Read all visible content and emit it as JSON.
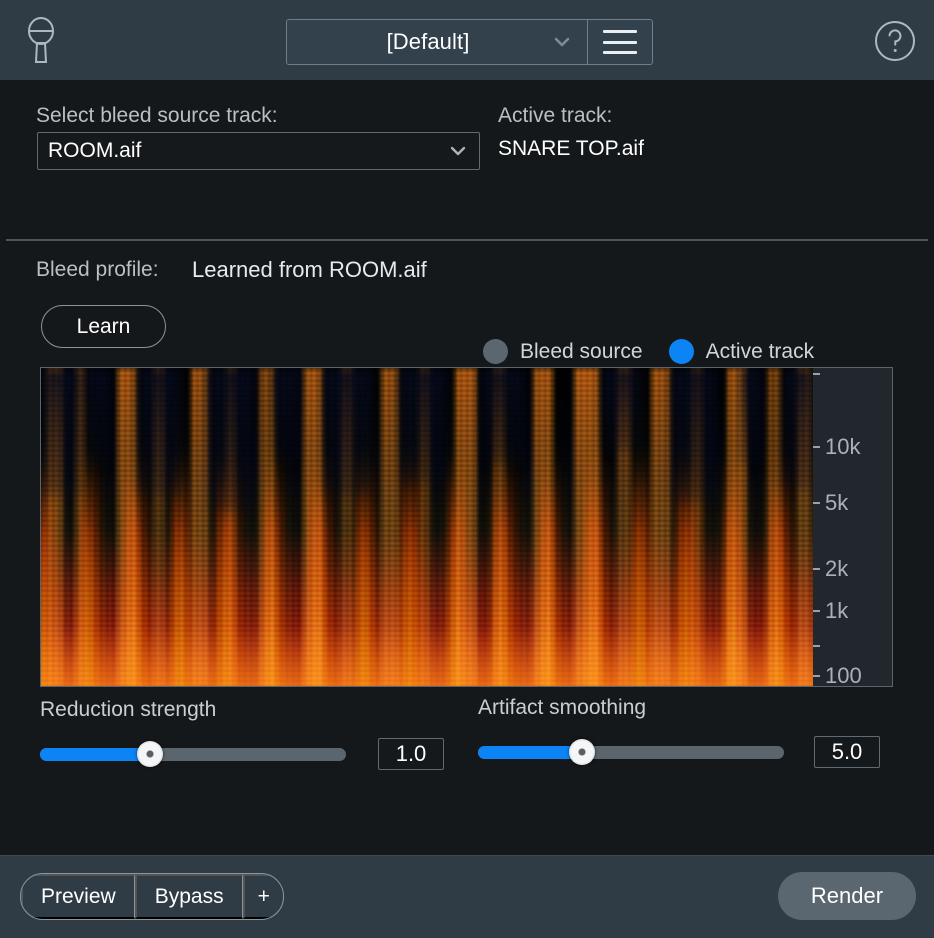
{
  "header": {
    "mic_icon": "microphone-icon",
    "help_icon": "help-icon",
    "preset_value": "[Default]",
    "preset_chevron": "chevron-down-icon",
    "menu_icon": "hamburger-menu-icon"
  },
  "top": {
    "bleed_source_label": "Select bleed source track:",
    "bleed_source_value": "ROOM.aif",
    "active_track_label": "Active track:",
    "active_track_value": "SNARE TOP.aif"
  },
  "profile": {
    "label": "Bleed profile:",
    "value": "Learned from ROOM.aif",
    "learn_button": "Learn"
  },
  "legend": {
    "items": [
      {
        "label": "Bleed source",
        "color": "#5b6670",
        "selected": false
      },
      {
        "label": "Active track",
        "color": "#0c84f5",
        "selected": true
      }
    ]
  },
  "spectrogram": {
    "freq_ticks": [
      {
        "label": "",
        "y_pct": 2
      },
      {
        "label": "10k",
        "y_pct": 24.8
      },
      {
        "label": "5k",
        "y_pct": 42.4
      },
      {
        "label": "2k",
        "y_pct": 63.3
      },
      {
        "label": "1k",
        "y_pct": 76.4
      },
      {
        "label": "",
        "y_pct": 87.5
      },
      {
        "label": "100",
        "y_pct": 97.0
      }
    ],
    "bleed_color": "#16254a",
    "active_color": "#f08a1e"
  },
  "controls": [
    {
      "title": "Reduction strength",
      "value": "1.0",
      "fill_pct": 36
    },
    {
      "title": "Artifact smoothing",
      "value": "5.0",
      "fill_pct": 34
    }
  ],
  "footer": {
    "preview_label": "Preview",
    "bypass_label": "Bypass",
    "add_label": "+",
    "render_label": "Render"
  }
}
